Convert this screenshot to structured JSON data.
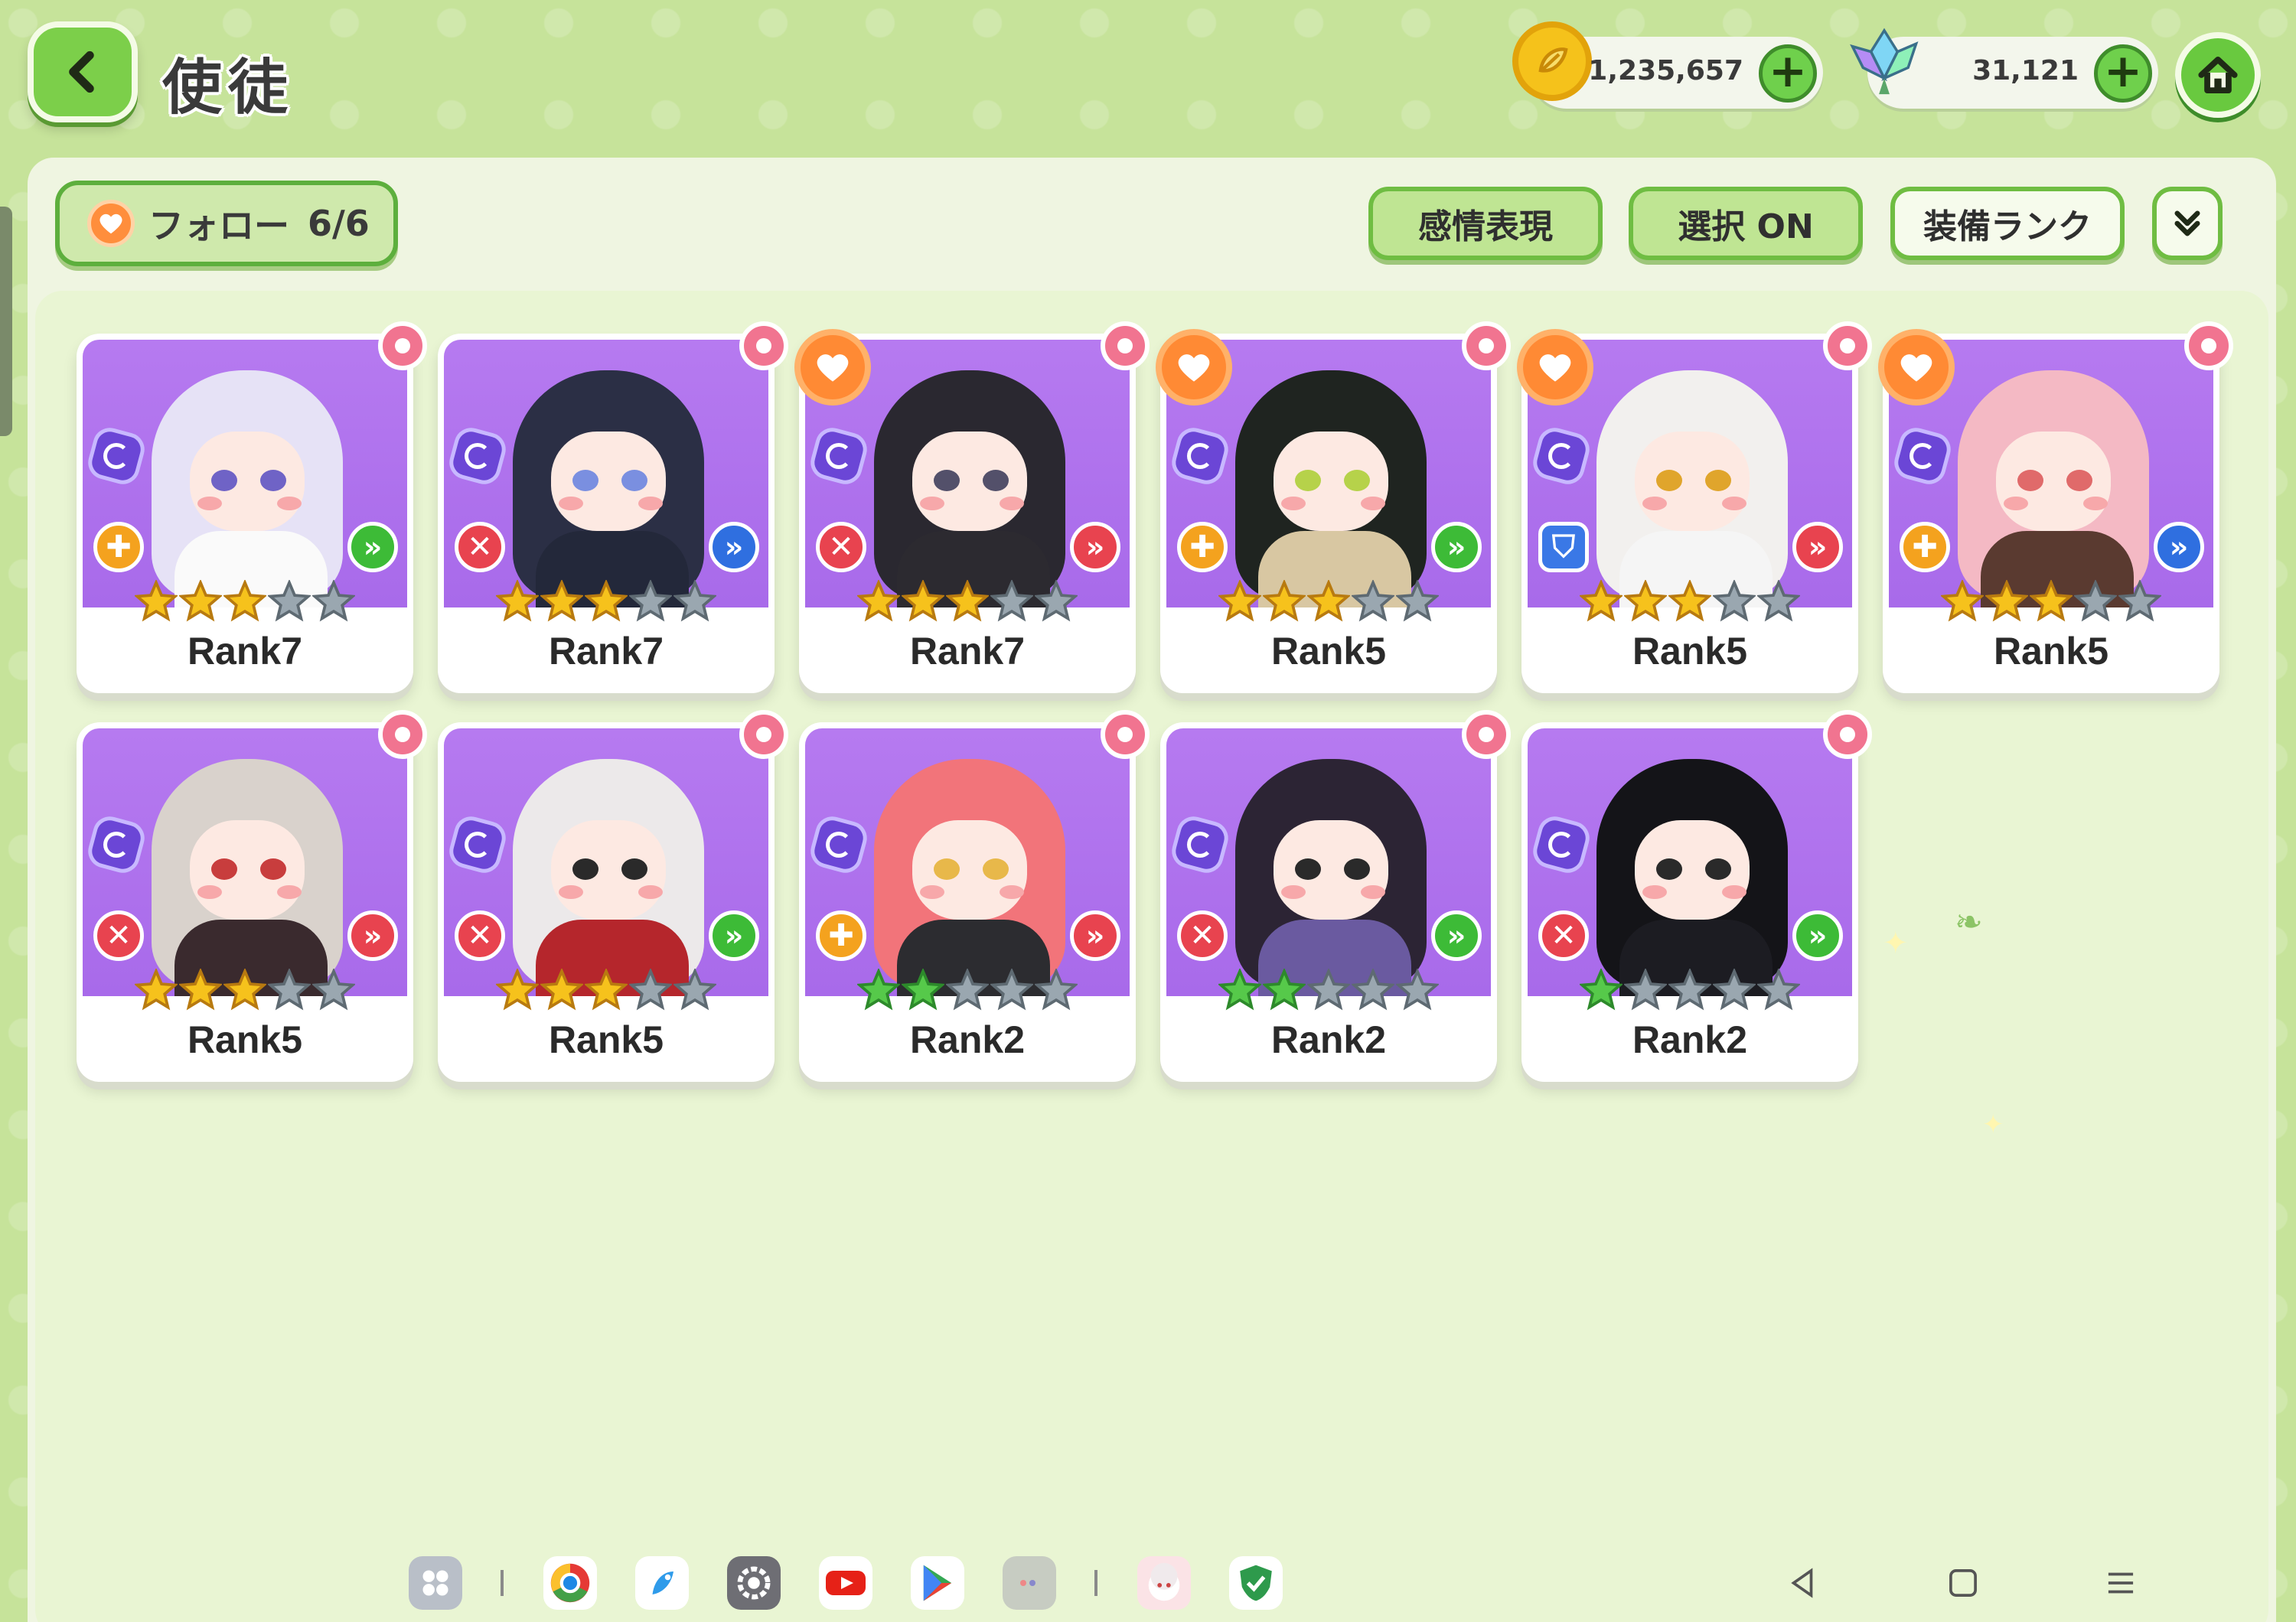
{
  "header": {
    "title": "使徒",
    "gold": "1,235,657",
    "gems": "31,121"
  },
  "toolbar": {
    "follow_label": "フォロー",
    "follow_count": "6/6",
    "emotion_label": "感情表現",
    "select_label": "選択 ON",
    "equip_rank_label": "装備ランク"
  },
  "cards": [
    {
      "rank": "Rank7",
      "favorite": false,
      "role": "heal",
      "position": "front",
      "stars": 3,
      "star_color": "gold",
      "hair": "#e6e2f6",
      "body": "#fafafa",
      "eye": "#6f63c6"
    },
    {
      "rank": "Rank7",
      "favorite": false,
      "role": "attack",
      "position": "back",
      "stars": 3,
      "star_color": "gold",
      "hair": "#2b2f45",
      "body": "#23283a",
      "eye": "#7a8fe0"
    },
    {
      "rank": "Rank7",
      "favorite": true,
      "role": "attack",
      "position": "mid",
      "stars": 3,
      "star_color": "gold",
      "hair": "#2a2830",
      "body": "#2c2a30",
      "eye": "#53506a"
    },
    {
      "rank": "Rank5",
      "favorite": true,
      "role": "heal",
      "position": "front",
      "stars": 3,
      "star_color": "gold",
      "hair": "#1f2420",
      "body": "#d8c7a2",
      "eye": "#b6d24a"
    },
    {
      "rank": "Rank5",
      "favorite": true,
      "role": "tank",
      "position": "mid",
      "stars": 3,
      "star_color": "gold",
      "hair": "#f2f0ee",
      "body": "#f5f5f5",
      "eye": "#e0a52c"
    },
    {
      "rank": "Rank5",
      "favorite": true,
      "role": "heal",
      "position": "back",
      "stars": 3,
      "star_color": "gold",
      "hair": "#f4b9c4",
      "body": "#5a3a30",
      "eye": "#e06a6a"
    },
    {
      "rank": "Rank5",
      "favorite": false,
      "role": "attack",
      "position": "mid",
      "stars": 3,
      "star_color": "gold",
      "hair": "#d9d2cc",
      "body": "#3a2a2e",
      "eye": "#c83d3d"
    },
    {
      "rank": "Rank5",
      "favorite": false,
      "role": "attack",
      "position": "front",
      "stars": 3,
      "star_color": "gold",
      "hair": "#ece9ea",
      "body": "#b5262c",
      "eye": "#2a2a2a"
    },
    {
      "rank": "Rank2",
      "favorite": false,
      "role": "heal",
      "position": "mid",
      "stars": 2,
      "star_color": "green",
      "hair": "#f2747a",
      "body": "#2c2c30",
      "eye": "#e8b84a"
    },
    {
      "rank": "Rank2",
      "favorite": false,
      "role": "attack",
      "position": "front",
      "stars": 2,
      "star_color": "green",
      "hair": "#2c2434",
      "body": "#6a5aa0",
      "eye": "#2a2a2a"
    },
    {
      "rank": "Rank2",
      "favorite": false,
      "role": "attack",
      "position": "front",
      "stars": 1,
      "star_color": "green",
      "hair": "#141418",
      "body": "#1c1c22",
      "eye": "#2a2a2a"
    }
  ],
  "colors": {
    "background": "#c6e39a",
    "panel": "#eff5e1",
    "card_art": "#b37af0",
    "accent_green": "#6fbd42"
  },
  "taskbar": {
    "apps": [
      "app-drawer-icon",
      "chrome-icon",
      "browser-bird-icon",
      "settings-icon",
      "youtube-icon",
      "play-store-icon",
      "folder-icon",
      "game-icon",
      "security-icon"
    ],
    "nav": [
      "back-nav-icon",
      "home-nav-icon",
      "recents-nav-icon"
    ]
  }
}
